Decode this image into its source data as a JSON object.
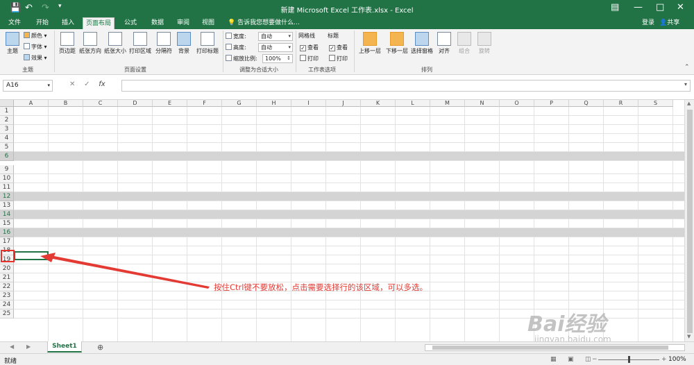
{
  "window": {
    "title": "新建 Microsoft Excel 工作表.xlsx - Excel",
    "qa_icons": [
      "save-icon",
      "undo-icon",
      "redo-icon",
      "customize-icon"
    ],
    "win_buttons": [
      "ribbon-display-icon",
      "minimize-icon",
      "maximize-icon",
      "close-icon"
    ]
  },
  "tabs": [
    {
      "label": "文件",
      "active": false
    },
    {
      "label": "开始",
      "active": false
    },
    {
      "label": "插入",
      "active": false
    },
    {
      "label": "页面布局",
      "active": true
    },
    {
      "label": "公式",
      "active": false
    },
    {
      "label": "数据",
      "active": false
    },
    {
      "label": "审阅",
      "active": false
    },
    {
      "label": "视图",
      "active": false
    }
  ],
  "tellme": "告诉我您想要做什么...",
  "login": "登录",
  "share": "共享",
  "ribbon": {
    "theme": {
      "main": "主题",
      "colors": "颜色",
      "fonts": "字体",
      "effects": "效果",
      "group": "主题"
    },
    "page_setup": {
      "buttons": [
        "页边距",
        "纸张方向",
        "纸张大小",
        "打印区域",
        "分隔符",
        "背景",
        "打印标题"
      ],
      "group": "页面设置"
    },
    "scale": {
      "width_label": "宽度:",
      "width_value": "自动",
      "height_label": "高度:",
      "height_value": "自动",
      "scale_label": "缩放比例:",
      "scale_value": "100%",
      "group": "调整为合适大小"
    },
    "sheet_options": {
      "gridlines": "网格线",
      "headings": "标题",
      "view": "查看",
      "print": "打印",
      "group": "工作表选项"
    },
    "arrange": {
      "buttons": [
        "上移一层",
        "下移一层",
        "选择窗格",
        "对齐",
        "组合",
        "旋转"
      ],
      "group": "排列"
    }
  },
  "formula_bar": {
    "name_box": "A16",
    "fx": "fx",
    "formula": ""
  },
  "columns": [
    "A",
    "B",
    "C",
    "D",
    "E",
    "F",
    "G",
    "H",
    "I",
    "J",
    "K",
    "L",
    "M",
    "N",
    "O",
    "P",
    "Q",
    "R",
    "S"
  ],
  "rows": [
    "1",
    "2",
    "3",
    "4",
    "5",
    "6",
    "9",
    "10",
    "11",
    "12",
    "13",
    "14",
    "15",
    "16",
    "17",
    "18",
    "19",
    "20",
    "21",
    "22",
    "23",
    "24",
    "25"
  ],
  "selected_rows": [
    "6",
    "12",
    "14",
    "16"
  ],
  "active_cell": "A16",
  "annotation": "按住Ctrl键不要放松，点击需要选择行的该区域，可以多选。",
  "sheet_tab": "Sheet1",
  "status": "就绪",
  "zoom": "100%",
  "watermark": "Bai经验",
  "watermark_url": "jingyan.baidu.com",
  "colors": {
    "excel_green": "#217346",
    "selection_grey": "#d4d4d4",
    "annotation_red": "#e33a34"
  }
}
